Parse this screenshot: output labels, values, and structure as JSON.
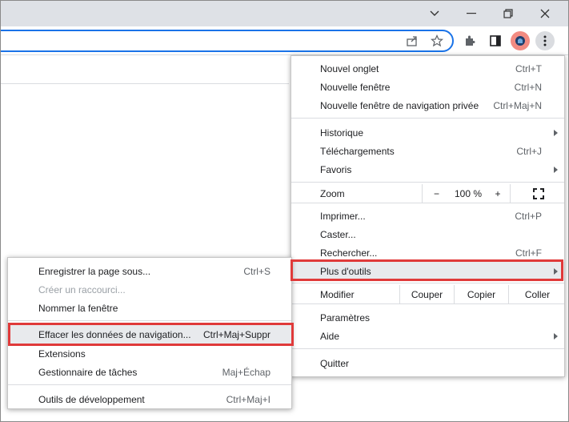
{
  "window": {
    "minimize_glyph": "⌄",
    "restore_glyph": "❐",
    "close_glyph": "✕"
  },
  "toolbar": {
    "icons": [
      "share-icon",
      "bookmark-star-icon",
      "extensions-icon",
      "side-panel-icon",
      "profile-avatar",
      "more-menu-icon"
    ]
  },
  "main_menu": {
    "new_tab": {
      "label": "Nouvel onglet",
      "shortcut": "Ctrl+T"
    },
    "new_window": {
      "label": "Nouvelle fenêtre",
      "shortcut": "Ctrl+N"
    },
    "new_incognito": {
      "label": "Nouvelle fenêtre de navigation privée",
      "shortcut": "Ctrl+Maj+N"
    },
    "history": {
      "label": "Historique"
    },
    "downloads": {
      "label": "Téléchargements",
      "shortcut": "Ctrl+J"
    },
    "favorites": {
      "label": "Favoris"
    },
    "zoom": {
      "label": "Zoom",
      "minus": "−",
      "value": "100 %",
      "plus": "+"
    },
    "print": {
      "label": "Imprimer...",
      "shortcut": "Ctrl+P"
    },
    "cast": {
      "label": "Caster..."
    },
    "find": {
      "label": "Rechercher...",
      "shortcut": "Ctrl+F"
    },
    "more_tools": {
      "label": "Plus d'outils"
    },
    "edit": {
      "label": "Modifier",
      "cut": "Couper",
      "copy": "Copier",
      "paste": "Coller"
    },
    "settings": {
      "label": "Paramètres"
    },
    "help": {
      "label": "Aide"
    },
    "quit": {
      "label": "Quitter"
    }
  },
  "sub_menu": {
    "save_page": {
      "label": "Enregistrer la page sous...",
      "shortcut": "Ctrl+S"
    },
    "create_shortcut": {
      "label": "Créer un raccourci..."
    },
    "name_window": {
      "label": "Nommer la fenêtre"
    },
    "clear_data": {
      "label": "Effacer les données de navigation...",
      "shortcut": "Ctrl+Maj+Suppr"
    },
    "extensions": {
      "label": "Extensions"
    },
    "task_manager": {
      "label": "Gestionnaire de tâches",
      "shortcut": "Maj+Échap"
    },
    "dev_tools": {
      "label": "Outils de développement",
      "shortcut": "Ctrl+Maj+I"
    }
  },
  "colors": {
    "highlight": "#e03a3a",
    "accent": "#1a73e8",
    "avatar_bg": "#f28b82"
  }
}
